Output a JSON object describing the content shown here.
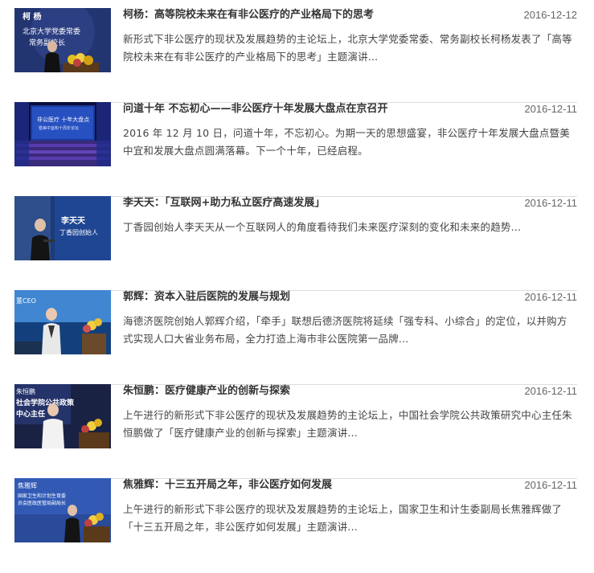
{
  "articles": [
    {
      "title": "柯杨：高等院校未来在有非公医疗的产业格局下的思考",
      "date": "2016-12-12",
      "summary": "新形式下非公医疗的现状及发展趋势的主论坛上，北京大学党委常委、常务副校长柯杨发表了「高等院校未来在有非公医疗的产业格局下的思考」主题演讲...",
      "thumb_text": [
        "柯 杨",
        "北京大学党委常委",
        "常务副校长"
      ]
    },
    {
      "title": "问道十年 不忘初心——非公医疗十年发展大盘点在京召开",
      "date": "2016-12-11",
      "summary": "2016 年 12 月 10 日，问道十年，不忘初心。为期一天的思想盛宴，非公医疗十年发展大盘点暨美中宜和发展大盘点圆满落幕。下一个十年，已经启程。",
      "thumb_text": [
        "非公医疗 十年大盘点",
        "暨美中宜和十周年论坛"
      ]
    },
    {
      "title": "李天天：「互联网+助力私立医疗高速发展」",
      "date": "2016-12-11",
      "summary": "丁香园创始人李天天从一个互联网人的角度看待我们未来医疗深刻的变化和未来的趋势...",
      "thumb_text": [
        "李天天",
        "丁香园创始人"
      ]
    },
    {
      "title": "郭辉：资本入驻后医院的发展与规划",
      "date": "2016-12-11",
      "summary": "海德济医院创始人郭辉介绍，「牵手」联想后德济医院将延续「强专科、小综合」的定位，以并购方式实现人口大省业务布局，全力打造上海市非公医院第一品牌...",
      "thumb_text": [
        "董CEO"
      ]
    },
    {
      "title": "朱恒鹏：医疗健康产业的创新与探索",
      "date": "2016-12-11",
      "summary": "上午进行的新形式下非公医疗的现状及发展趋势的主论坛上，中国社会学院公共政策研究中心主任朱恒鹏做了「医疗健康产业的创新与探索」主题演讲...",
      "thumb_text": [
        "朱恒鹏",
        "社会学院公共政策",
        "中心主任"
      ]
    },
    {
      "title": "焦雅辉：十三五开局之年，非公医疗如何发展",
      "date": "2016-12-11",
      "summary": "上午进行的新形式下非公医疗的现状及发展趋势的主论坛上，国家卫生和计生委副局长焦雅辉做了「十三五开局之年，非公医疗如何发展」主题演讲...",
      "thumb_text": [
        "焦雅辉",
        "国家卫生和计划生育委",
        "员会医政医管局副局长"
      ]
    }
  ],
  "colors": {
    "title": "#333333",
    "date": "#666666",
    "summary": "#444444",
    "divider": "#dddddd"
  }
}
